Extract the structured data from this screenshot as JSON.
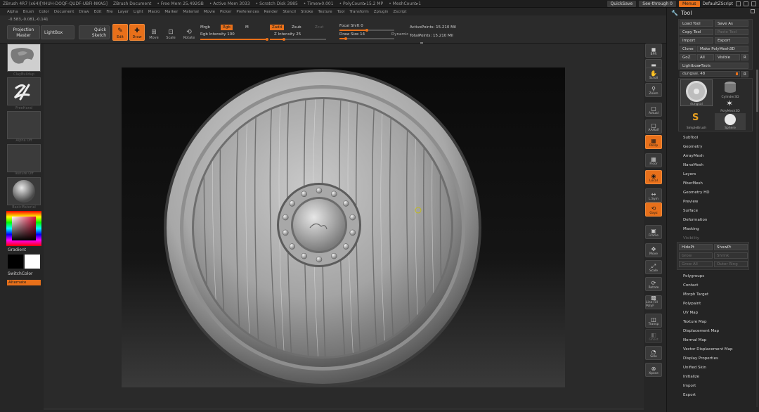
{
  "titlebar": {
    "app_title": "ZBrush 4R7 (x64)[YHUH-DOQF-QUDF-UBFI-NKAG]",
    "doc_title": "ZBrush Document",
    "free_mem": "• Free Mem 25.492GB",
    "active_mem": "• Active Mem 3033",
    "scratch_disk": "• Scratch Disk 3985",
    "timer": "• Timer▸0.001",
    "poly_count": "• PolyCount▸15.2 MP",
    "mesh_count": "• MeshCount▸1",
    "quicksave": "QuickSave",
    "see_through": "See-through 0",
    "menus": "Menus",
    "default_script": "DefaultZScript"
  },
  "menubar": {
    "items": [
      "Alpha",
      "Brush",
      "Color",
      "Document",
      "Draw",
      "Edit",
      "File",
      "Layer",
      "Light",
      "Macro",
      "Marker",
      "Material",
      "Movie",
      "Picker",
      "Preferences",
      "Render",
      "Stencil",
      "Stroke",
      "Texture",
      "Tool",
      "Transform",
      "Zplugin",
      "Zscript"
    ]
  },
  "toolbar": {
    "coords": "-0.583,-0.081,-0.141",
    "projection_master": "Projection Master",
    "lightbox": "LightBox",
    "quick_sketch": "Quick Sketch",
    "edit": "Edit",
    "draw": "Draw",
    "move": "Move",
    "scale": "Scale",
    "rotate": "Rotate",
    "mrgb": "Mrgb",
    "rgb": "Rgb",
    "m": "M",
    "rgb_intensity": "Rgb Intensity 100",
    "zadd": "Zadd",
    "zsub": "Zsub",
    "zcut": "Zcut",
    "z_intensity": "Z Intensity 25",
    "focal_shift": "Focal Shift 0",
    "draw_size": "Draw Size 14",
    "dynamic": "Dynamic",
    "active_points": "ActivePoints: 15.210 Mil",
    "total_points": "TotalPoints: 15.210 Mil",
    "rgb_intensity_value": 100,
    "z_intensity_value": 25,
    "draw_size_value": 14,
    "focal_shift_value": 0
  },
  "left_tray": {
    "brush_label": "ClayBuildup",
    "stroke_label": "FreeHand",
    "alpha_label": "Alpha Off",
    "texture_label": "Texture Off",
    "material_label": "BasicMaterial",
    "gradient": "Gradient",
    "switch_color": "SwitchColor",
    "alternate": "Alternate"
  },
  "right_shelf": {
    "buttons": [
      {
        "label": "BPR"
      },
      {
        "label": "SPix 3"
      },
      {
        "label": "Scroll"
      },
      {
        "label": "Zoom"
      },
      {
        "label": "Actual"
      },
      {
        "label": "AAHalf"
      },
      {
        "label": "Persp"
      },
      {
        "label": "Floor"
      },
      {
        "label": "Local"
      },
      {
        "label": "L.Sym"
      },
      {
        "label": "Gxyz"
      },
      {
        "label": "Frame"
      },
      {
        "label": "Move"
      },
      {
        "label": "Scale"
      },
      {
        "label": "Rotate"
      },
      {
        "label": "Line Fill PolyF"
      },
      {
        "label": "Transp"
      },
      {
        "label": "Ghost"
      },
      {
        "label": "Solo"
      },
      {
        "label": "Xpose"
      }
    ]
  },
  "tool_panel": {
    "title": "Tool",
    "load_tool": "Load Tool",
    "save_as": "Save As",
    "copy_tool": "Copy Tool",
    "paste_tool": "Paste Tool",
    "import": "Import",
    "export": "Export",
    "clone": "Clone",
    "make_polymesh": "Make PolyMesh3D",
    "goz": "GoZ",
    "all": "All",
    "visible": "Visible",
    "r": "R",
    "lightbox_tools": "Lightbox▸Tools",
    "current_tool": "dungsai. 48",
    "tiles": [
      {
        "caption": "dungsai"
      },
      {
        "caption": "Cylinder3D"
      },
      {
        "caption": "PolyMesh3D"
      },
      {
        "caption": "SimpleBrush"
      },
      {
        "caption": "Sphere"
      }
    ],
    "sections_top": [
      "SubTool",
      "Geometry",
      "ArrayMesh",
      "NanoMesh",
      "Layers",
      "FiberMesh",
      "Geometry HD",
      "Preview",
      "Surface",
      "Deformation",
      "Masking",
      "Visibility"
    ],
    "hidept": "HidePt",
    "showpt": "ShowPt",
    "grow": "Grow",
    "shrink": "Shrink",
    "grow_all": "Grow All",
    "outer_ring": "Outer Ring",
    "sections_bottom": [
      "Polygroups",
      "Contact",
      "Morph Target",
      "Polypaint",
      "UV Map",
      "Texture Map",
      "Displacement Map",
      "Normal Map",
      "Vector Displacement Map",
      "Display Properties",
      "Unified Skin",
      "Initialize",
      "Import",
      "Export"
    ]
  },
  "colors": {
    "accent": "#e8701a",
    "panel": "#262626",
    "canvas": "#0a0a0a",
    "primary_color": "#000000",
    "secondary_color": "#ffffff"
  }
}
